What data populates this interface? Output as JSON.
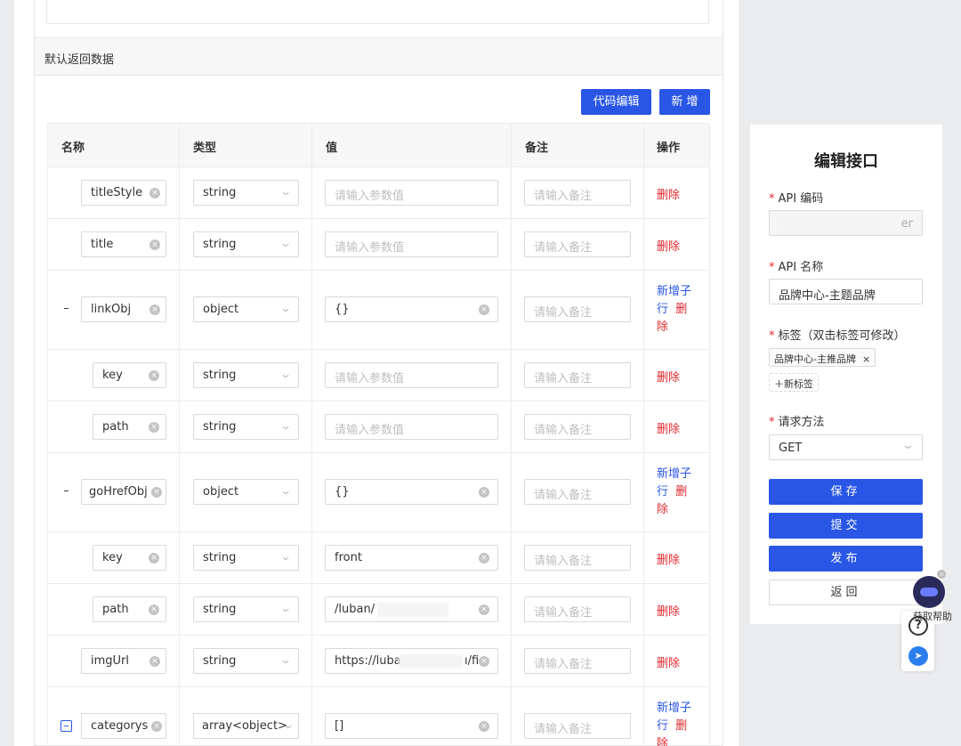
{
  "section_title": "默认返回数据",
  "toolbar": {
    "code_edit": "代码编辑",
    "add_new": "新 增"
  },
  "columns": {
    "name": "名称",
    "type": "类型",
    "value": "值",
    "note": "备注",
    "action": "操作"
  },
  "placeholders": {
    "value": "请输入参数值",
    "note": "请输入备注"
  },
  "actions": {
    "delete": "删除",
    "add_child_1": "新增子",
    "add_child_2": "行",
    "del_split_1": "删",
    "del_split_2": "除"
  },
  "rows": [
    {
      "name": "titleStyle",
      "type": "string",
      "value": ""
    },
    {
      "name": "title",
      "type": "string",
      "value": ""
    },
    {
      "name": "linkObj",
      "type": "object",
      "value": "{}"
    },
    {
      "name": "key",
      "type": "string",
      "value": ""
    },
    {
      "name": "path",
      "type": "string",
      "value": ""
    },
    {
      "name": "goHrefObj",
      "type": "object",
      "value": "{}"
    },
    {
      "name": "key",
      "type": "string",
      "value": "front"
    },
    {
      "name": "path",
      "type": "string",
      "value": "/luban/"
    },
    {
      "name": "imgUrl",
      "type": "string",
      "value": "https://lubai",
      "value_tail": "ı/fi"
    },
    {
      "name": "categorys",
      "type": "array<object>",
      "value": "[]"
    }
  ],
  "side": {
    "title": "编辑接口",
    "api_code_label": "API 编码",
    "api_code_value_tail": "er",
    "api_name_label": "API 名称",
    "api_name_value": "品牌中心-主题品牌",
    "tags_label": "标签（双击标签可修改）",
    "tag": "品牌中心-主推品牌",
    "tag_close": "×",
    "new_tag": "＋新标签",
    "method_label": "请求方法",
    "method_value": "GET",
    "save": "保存",
    "submit": "提交",
    "publish": "发布",
    "back": "返回"
  },
  "help": {
    "text": "获取帮助",
    "question": "?"
  }
}
